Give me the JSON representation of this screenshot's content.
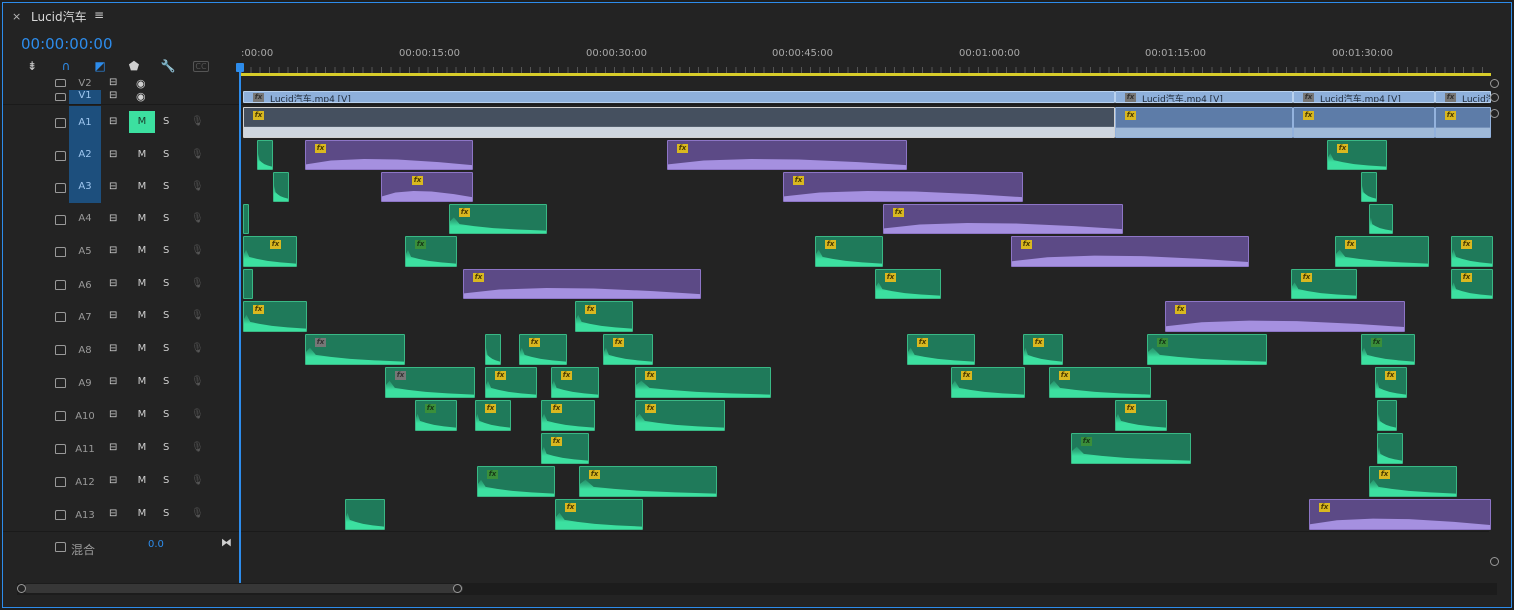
{
  "tab": {
    "close": "×",
    "title": "Lucid汽车",
    "menu": "≡"
  },
  "timecode": "00:00:00:00",
  "ruler": {
    "labels": [
      ":00:00",
      "00:00:15:00",
      "00:00:30:00",
      "00:00:45:00",
      "00:01:00:00",
      "00:01:15:00",
      "00:01:30:00"
    ]
  },
  "tracks": {
    "V2": "V2",
    "V1": "V1",
    "A1": "A1",
    "A2": "A2",
    "A3": "A3",
    "A4": "A4",
    "A5": "A5",
    "A6": "A6",
    "A7": "A7",
    "A8": "A8",
    "A9": "A9",
    "A10": "A10",
    "A11": "A11",
    "A12": "A12",
    "A13": "A13"
  },
  "buttons": {
    "mute": "M",
    "solo": "S"
  },
  "mix": {
    "label": "混合",
    "value": "0.0"
  },
  "clips": {
    "v1_label": "Lucid汽车.mp4 [V]",
    "fx": "fx"
  },
  "colors": {
    "accent": "#2d8ceb",
    "audio_clip": "#1f7a5a",
    "audio_wave": "#3ce0a0",
    "nested_clip": "#5c4a86",
    "video_clip": "#8eb0db",
    "work_area": "#d7cc2a"
  }
}
